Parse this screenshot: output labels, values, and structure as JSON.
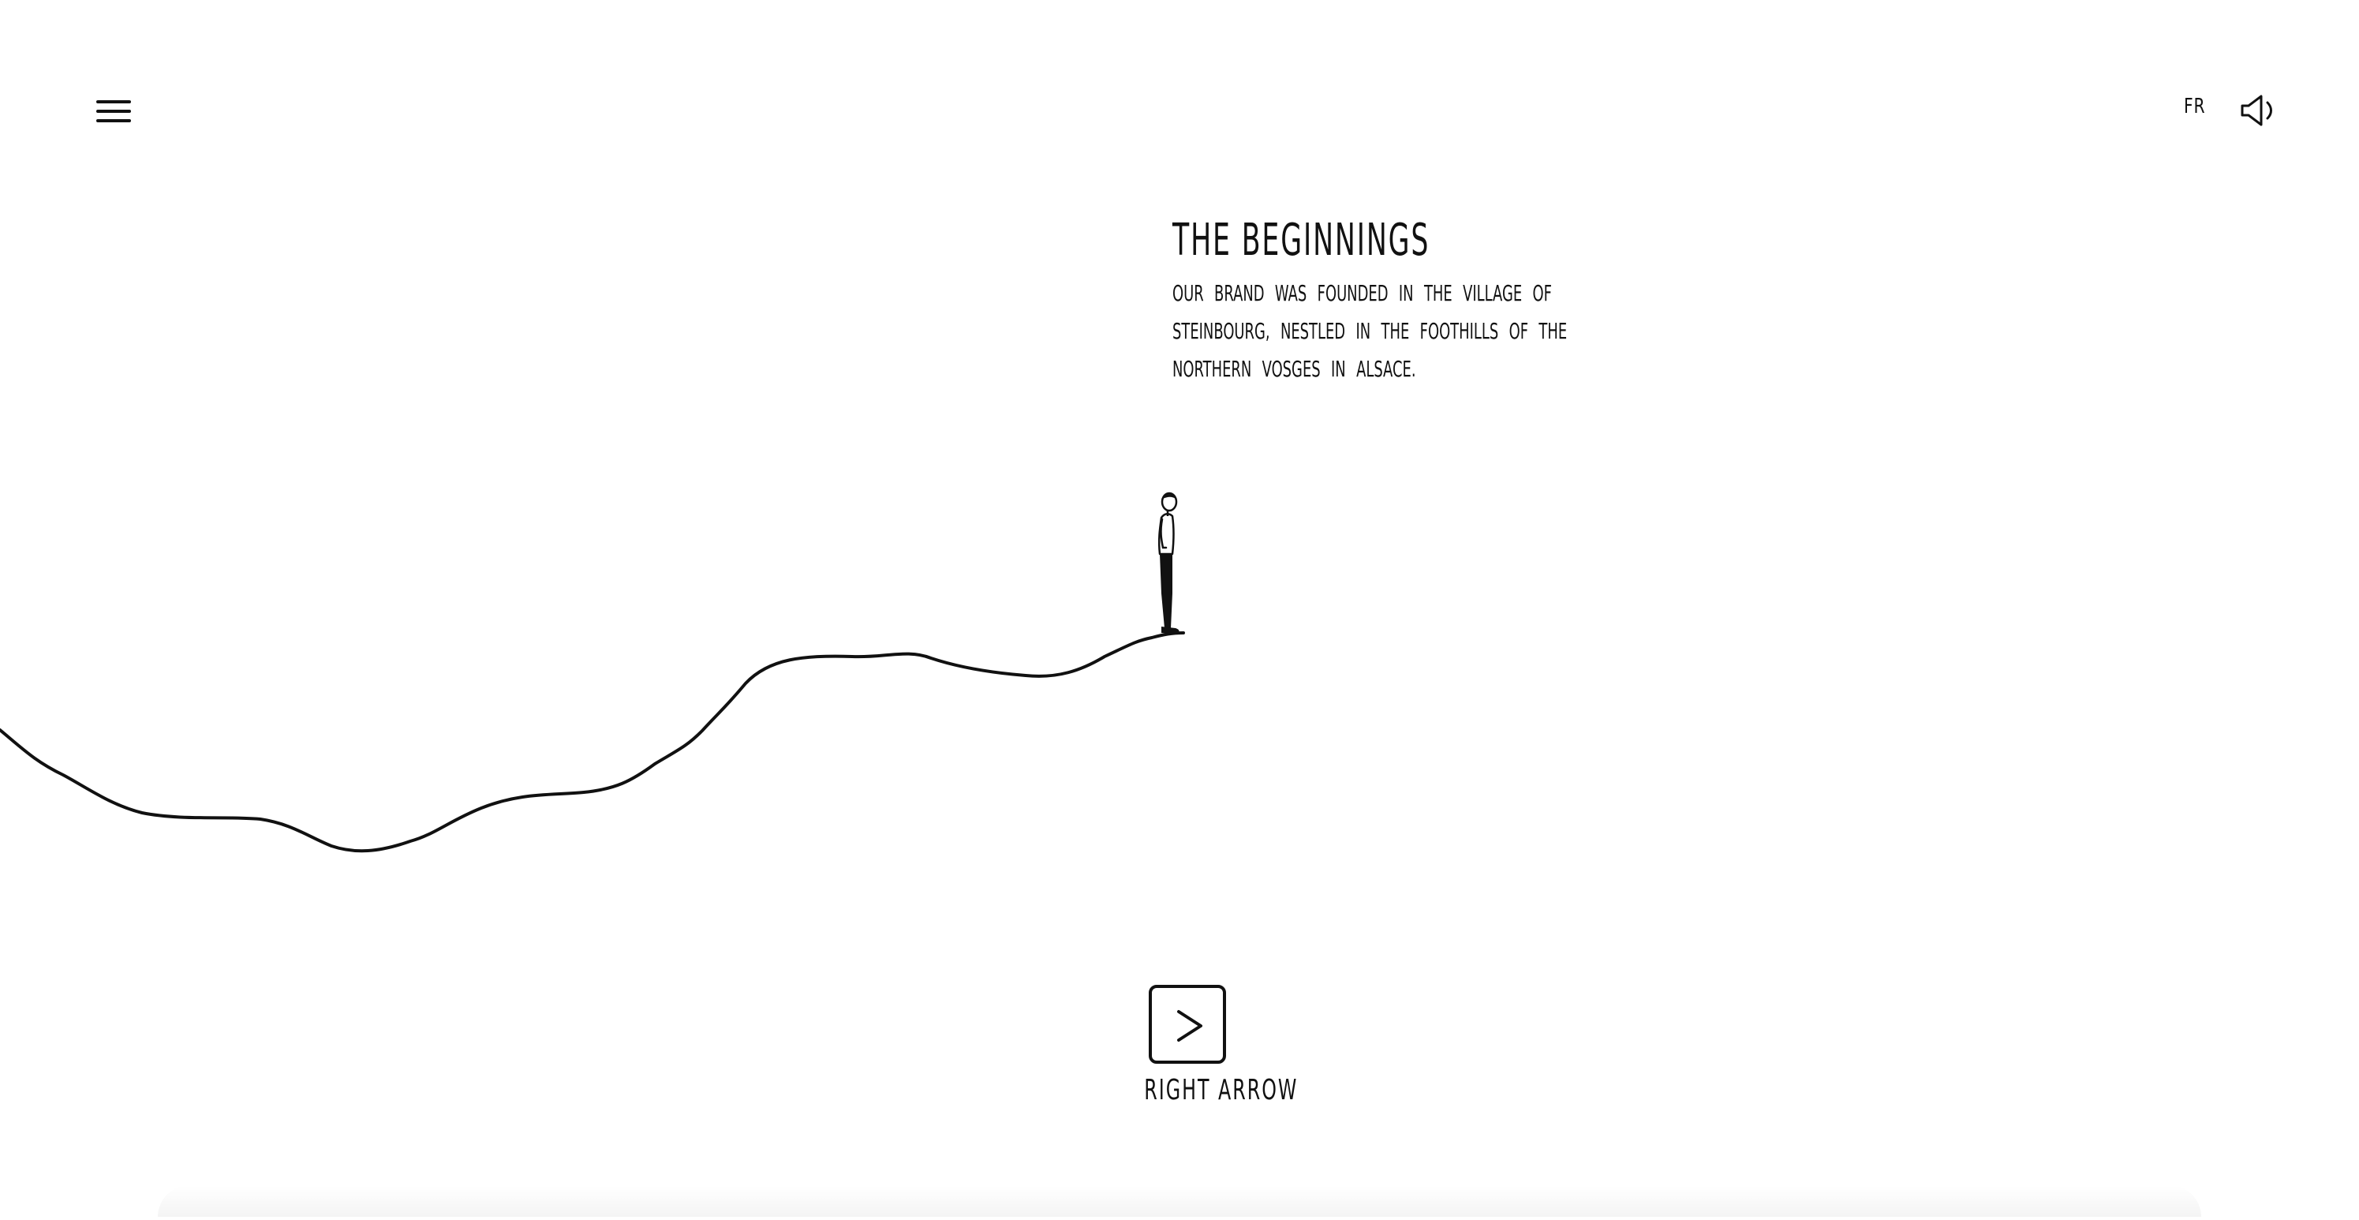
{
  "header": {
    "menu_icon": "hamburger-menu-icon",
    "language_label": "FR",
    "sound_icon": "speaker-sound-icon"
  },
  "story": {
    "title": "THE BEGINNINGS",
    "body": "OUR BRAND WAS FOUNDED IN THE VILLAGE OF STEINBOURG, NESTLED IN THE FOOTHILLS OF THE NORTHERN VOSGES IN ALSACE."
  },
  "navigation": {
    "next_icon": "chevron-right-icon",
    "next_label": "RIGHT ARROW"
  },
  "colors": {
    "background": "#ffffff",
    "ink": "#111111"
  }
}
